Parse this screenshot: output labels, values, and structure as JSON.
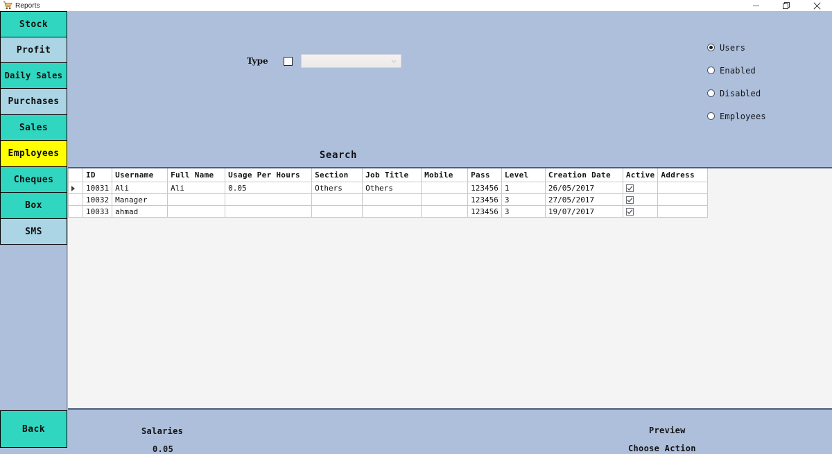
{
  "window": {
    "title": "Reports",
    "icon": "shopping-cart-icon",
    "minimize_label": "–",
    "maximize_label": "❐",
    "close_label": "✕"
  },
  "sidebar": {
    "items": [
      {
        "label": "Stock",
        "color": "#31d6c0",
        "state": "normal"
      },
      {
        "label": "Profit",
        "color": "#abd4e4",
        "state": "normal"
      },
      {
        "label": "Daily Sales",
        "color": "#31d6c0",
        "state": "normal"
      },
      {
        "label": "Purchases",
        "color": "#abd4e4",
        "state": "normal"
      },
      {
        "label": "Sales",
        "color": "#31d6c0",
        "state": "normal"
      },
      {
        "label": "Employees",
        "color": "#ffff00",
        "state": "selected"
      },
      {
        "label": "Cheques",
        "color": "#31d6c0",
        "state": "normal"
      },
      {
        "label": "Box",
        "color": "#31d6c0",
        "state": "normal"
      },
      {
        "label": "SMS",
        "color": "#abd4e4",
        "state": "normal"
      }
    ],
    "back_label": "Back"
  },
  "filters": {
    "type_label": "Type",
    "type_checkbox_checked": false,
    "type_value": "",
    "type_placeholder": "",
    "radios": [
      {
        "label": "Users",
        "selected": true
      },
      {
        "label": "Enabled",
        "selected": false
      },
      {
        "label": "Disabled",
        "selected": false
      },
      {
        "label": "Employees",
        "selected": false
      }
    ]
  },
  "search": {
    "title": "Search"
  },
  "grid": {
    "columns": [
      "ID",
      "Username",
      "Full Name",
      "Usage Per Hours",
      "Section",
      "Job Title",
      "Mobile",
      "Pass",
      "Level",
      "Creation Date",
      "Active",
      "Address"
    ],
    "rows": [
      {
        "selected": true,
        "ID": "10031",
        "Username": "Ali",
        "Full Name": "Ali",
        "Usage Per Hours": "0.05",
        "Section": "Others",
        "Job Title": "Others",
        "Mobile": "",
        "Pass": "123456",
        "Level": "1",
        "Creation Date": "26/05/2017",
        "Active": true,
        "Address": ""
      },
      {
        "selected": false,
        "ID": "10032",
        "Username": "Manager",
        "Full Name": "",
        "Usage Per Hours": "",
        "Section": "",
        "Job Title": "",
        "Mobile": "",
        "Pass": "123456",
        "Level": "3",
        "Creation Date": "27/05/2017",
        "Active": true,
        "Address": ""
      },
      {
        "selected": false,
        "ID": "10033",
        "Username": "ahmad",
        "Full Name": "",
        "Usage Per Hours": "",
        "Section": "",
        "Job Title": "",
        "Mobile": "",
        "Pass": "123456",
        "Level": "3",
        "Creation Date": "19/07/2017",
        "Active": true,
        "Address": ""
      }
    ]
  },
  "footer": {
    "salaries_label": "Salaries",
    "salaries_value": "0.05",
    "preview_label": "Preview",
    "choose_action_label": "Choose Action"
  },
  "colors": {
    "background": "#aebfdb",
    "accent_teal": "#31d6c0",
    "accent_lightblue": "#abd4e4",
    "accent_yellow": "#ffff00",
    "selection_blue": "#1a7fd4",
    "panel_white": "#f4f4f4"
  }
}
